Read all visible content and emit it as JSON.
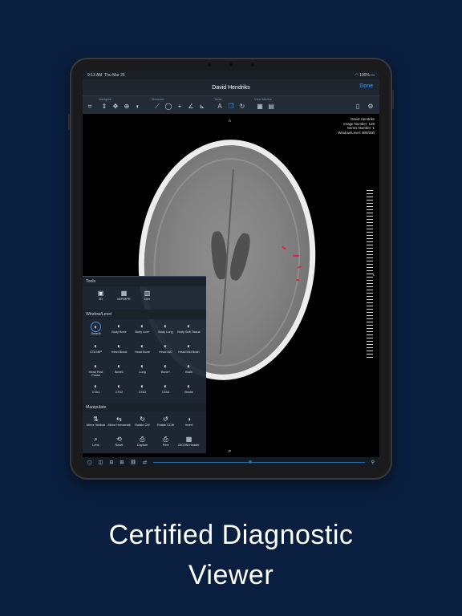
{
  "status_bar": {
    "time": "9:13 AM",
    "date": "Thu Mar 25",
    "battery": "100%"
  },
  "nav": {
    "title": "David Hendriks",
    "done": "Done"
  },
  "toolbar_groups": {
    "navigate": "Navigate",
    "measure": "Measure",
    "tools": "Tools",
    "view_modes": "View Modes"
  },
  "image_overlay": {
    "patient": "David Hendriks",
    "image_number": "Image Number: 129",
    "series_number": "Series Number: 1",
    "window_level": "Window/Level: 800/200"
  },
  "orientation": {
    "top": "A",
    "bottom": "P",
    "right": "L"
  },
  "panel": {
    "tools_header": "Tools",
    "tools": [
      {
        "label": "3D",
        "icon": "cube-icon"
      },
      {
        "label": "MIP/MPR",
        "icon": "mpr-icon"
      },
      {
        "label": "Cine",
        "icon": "film-icon"
      }
    ],
    "window_header": "Window/Level",
    "presets": [
      "Default",
      "Body Bone",
      "Body Liver",
      "Body Lung",
      "Body Soft Tissue",
      "CTA MIP",
      "Head Blood",
      "Head Bone",
      "Head IAC",
      "Head Mid Brain",
      "Head Post Fossa",
      "Bone1",
      "Lung",
      "Bone+",
      "Brain",
      "CTA1",
      "CTA2",
      "CTA3",
      "CTA4",
      "Stroke"
    ],
    "manipulate_header": "Manipulate",
    "manipulate": [
      "Mirror Vertical",
      "Mirror Horizontal",
      "Rotate CW",
      "Rotate CCW",
      "Invert",
      "Lens",
      "Reset",
      "Capture",
      "Print",
      "DICOM Header"
    ],
    "footer": "A Y1 Quality: 100"
  },
  "caption": {
    "line1": "Certified Diagnostic",
    "line2": "Viewer"
  },
  "colors": {
    "background": "#0a1f3f",
    "accent": "#3a9bff",
    "lesion": "#e0243b"
  }
}
